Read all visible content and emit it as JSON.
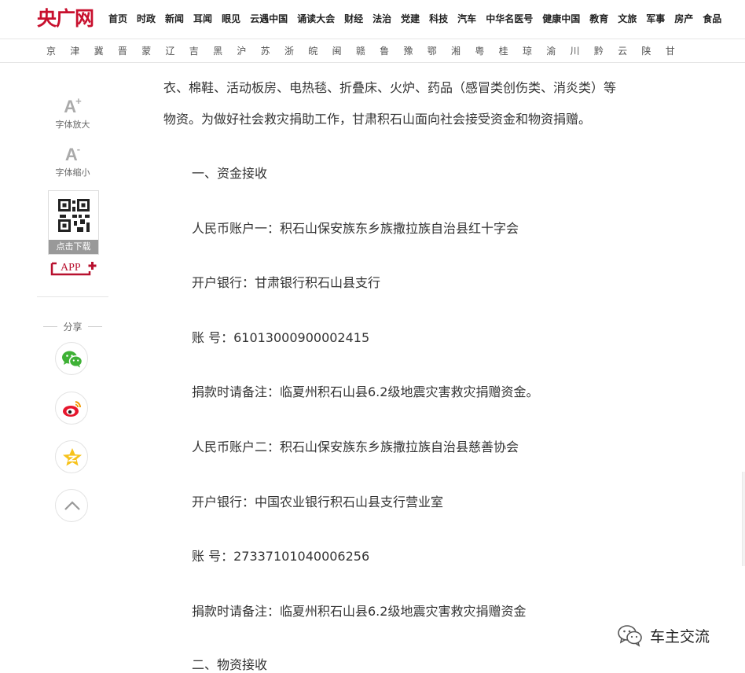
{
  "header": {
    "logo": "央广网",
    "nav": [
      "首页",
      "时政",
      "新闻",
      "耳闻",
      "眼见",
      "云遇中国",
      "诵读大会",
      "财经",
      "法治",
      "党建",
      "科技",
      "汽车",
      "中华名医号",
      "健康中国",
      "教育",
      "文旅",
      "军事",
      "房产",
      "食品"
    ]
  },
  "provinces": [
    "京",
    "津",
    "冀",
    "晋",
    "蒙",
    "辽",
    "吉",
    "黑",
    "沪",
    "苏",
    "浙",
    "皖",
    "闽",
    "赣",
    "鲁",
    "豫",
    "鄂",
    "湘",
    "粤",
    "桂",
    "琼",
    "渝",
    "川",
    "黔",
    "云",
    "陕",
    "甘"
  ],
  "tools": {
    "font_up_symbol": "A",
    "font_up_sup": "+",
    "font_up_label": "字体放大",
    "font_down_symbol": "A",
    "font_down_sup": "-",
    "font_down_label": "字体缩小",
    "download_label": "点击下载",
    "app_label": "APP",
    "share_label": "分享"
  },
  "article": {
    "lines": [
      "衣、棉鞋、活动板房、电热毯、折叠床、火炉、药品（感冒类创伤类、消炎类）等",
      "物资。为做好社会救灾捐助工作，甘肃积石山面向社会接受资金和物资捐赠。",
      "一、资金接收",
      "人民币账户一：积石山保安族东乡族撒拉族自治县红十字会",
      "开户银行：甘肃银行积石山县支行",
      "账 号：61013000900002415",
      "捐款时请备注：临夏州积石山县6.2级地震灾害救灾捐赠资金。",
      "人民币账户二：积石山保安族东乡族撒拉族自治县慈善协会",
      "开户银行：中国农业银行积石山县支行营业室",
      "账 号：27337101040006256",
      "捐款时请备注：临夏州积石山县6.2级地震灾害救灾捐赠资金",
      "二、物资接收"
    ]
  },
  "watermark": "车主交流",
  "colors": {
    "brand": "#c8102e",
    "wechat": "#3eb135",
    "weibo": "#e6162d",
    "qzone": "#f7c21a"
  }
}
